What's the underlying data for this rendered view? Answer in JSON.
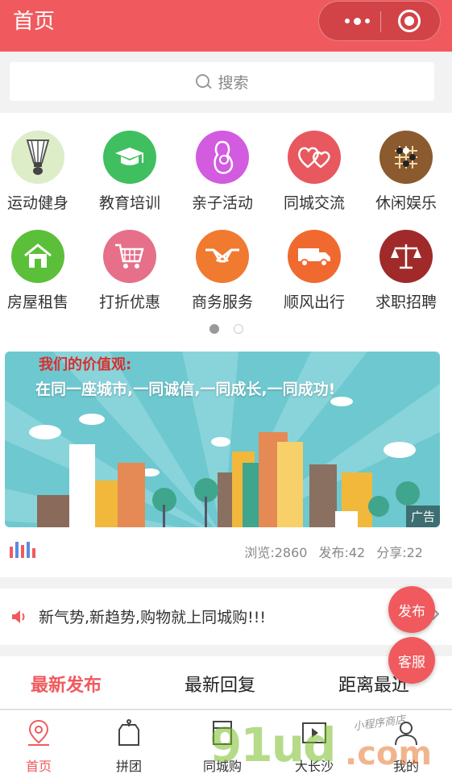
{
  "header": {
    "title": "首页"
  },
  "search": {
    "placeholder": "搜索"
  },
  "categories": [
    {
      "label": "运动健身",
      "icon": "badminton-icon",
      "color": "#d9ecc7"
    },
    {
      "label": "教育培训",
      "icon": "graduation-cap-icon",
      "color": "#3fbf5f"
    },
    {
      "label": "亲子活动",
      "icon": "parent-child-icon",
      "color": "#d25be0"
    },
    {
      "label": "同城交流",
      "icon": "hearts-icon",
      "color": "#e8585f"
    },
    {
      "label": "休闲娱乐",
      "icon": "chess-board-icon",
      "color": "#8b5a2e"
    },
    {
      "label": "房屋租售",
      "icon": "house-icon",
      "color": "#5cbf3a"
    },
    {
      "label": "打折优惠",
      "icon": "shopping-cart-icon",
      "color": "#e67089"
    },
    {
      "label": "商务服务",
      "icon": "handshake-icon",
      "color": "#f07a30"
    },
    {
      "label": "顺风出行",
      "icon": "truck-icon",
      "color": "#f06a30"
    },
    {
      "label": "求职招聘",
      "icon": "scales-icon",
      "color": "#a02a2a"
    }
  ],
  "banner": {
    "line1": "我们的价值观:",
    "line2": "在同一座城市,一同诚信,一同成长,一同成功!",
    "ad_tag": "广告"
  },
  "stats": {
    "views": "浏览:2860",
    "posts": "发布:42",
    "shares": "分享:22"
  },
  "notice": {
    "message": "新气势,新趋势,购物就上同城购!!!"
  },
  "tabs": [
    "最新发布",
    "最新回复",
    "距离最近"
  ],
  "fab": {
    "publish": "发布",
    "service": "客服"
  },
  "nav": [
    "首页",
    "拼团",
    "同城购",
    "大长沙",
    "我的"
  ],
  "watermark": {
    "main": "91ud",
    "suffix": ".com",
    "tagline": "小程序商店"
  },
  "colors": {
    "brand": "#f05a5e"
  }
}
